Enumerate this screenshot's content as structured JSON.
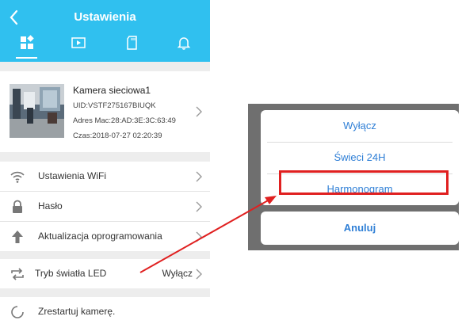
{
  "header": {
    "title": "Ustawienia",
    "back_icon": "chevron-left-icon"
  },
  "tabs": [
    {
      "icon": "grid-settings-icon",
      "active": true
    },
    {
      "icon": "play-video-icon"
    },
    {
      "icon": "sd-card-icon"
    },
    {
      "icon": "bell-icon"
    }
  ],
  "camera": {
    "name": "Kamera sieciowa1",
    "uid": "UID:VSTF275167BIUQK",
    "mac": "Adres Mac:28:AD:3E:3C:63:49",
    "time": "Czas:2018-07-27 02:20:39"
  },
  "settings": {
    "wifi": "Ustawienia WiFi",
    "password": "Hasło",
    "firmware": "Aktualizacja oprogramowania",
    "led_mode": "Tryb światła LED",
    "led_value": "Wyłącz",
    "restart": "Zrestartuj kamerę."
  },
  "dialog": {
    "options": [
      "Wyłącz",
      "Świeci 24H",
      "Harmonogram"
    ],
    "cancel": "Anuluj",
    "highlighted": "Harmonogram"
  },
  "colors": {
    "header": "#30c0ef",
    "link": "#2f7fd6",
    "highlight": "#e02020"
  }
}
